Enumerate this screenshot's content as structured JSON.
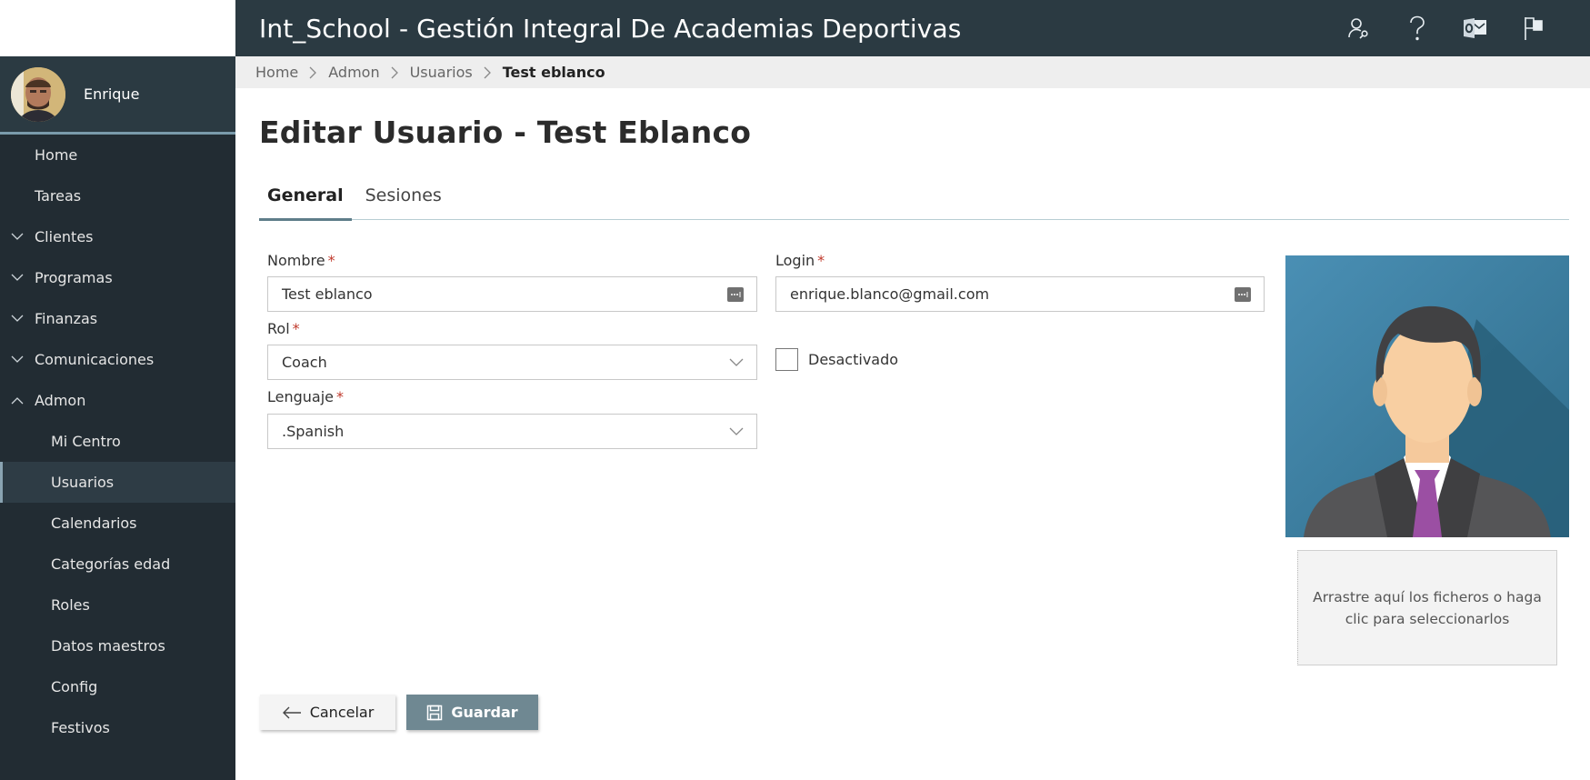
{
  "header": {
    "title": "Int_School - Gestión Integral De Academias Deportivas",
    "icons": [
      "user-search-icon",
      "help-icon",
      "outlook-icon",
      "flag-icon"
    ]
  },
  "user": {
    "name": "Enrique"
  },
  "sidebar": {
    "items": [
      {
        "label": "Home",
        "type": "top"
      },
      {
        "label": "Tareas",
        "type": "top"
      },
      {
        "label": "Clientes",
        "type": "group",
        "expanded": false
      },
      {
        "label": "Programas",
        "type": "group",
        "expanded": false
      },
      {
        "label": "Finanzas",
        "type": "group",
        "expanded": false
      },
      {
        "label": "Comunicaciones",
        "type": "group",
        "expanded": false
      },
      {
        "label": "Admon",
        "type": "group",
        "expanded": true
      },
      {
        "label": "Mi Centro",
        "type": "sub"
      },
      {
        "label": "Usuarios",
        "type": "sub",
        "active": true
      },
      {
        "label": "Calendarios",
        "type": "sub"
      },
      {
        "label": "Categorías edad",
        "type": "sub"
      },
      {
        "label": "Roles",
        "type": "sub"
      },
      {
        "label": "Datos maestros",
        "type": "sub"
      },
      {
        "label": "Config",
        "type": "sub"
      },
      {
        "label": "Festivos",
        "type": "sub"
      }
    ]
  },
  "breadcrumb": [
    "Home",
    "Admon",
    "Usuarios",
    "Test eblanco"
  ],
  "page": {
    "title": "Editar Usuario - Test Eblanco"
  },
  "tabs": [
    {
      "label": "General",
      "active": true
    },
    {
      "label": "Sesiones",
      "active": false
    }
  ],
  "form": {
    "nombre": {
      "label": "Nombre",
      "required": "*",
      "value": "Test eblanco"
    },
    "login": {
      "label": "Login",
      "required": "*",
      "value": "enrique.blanco@gmail.com"
    },
    "rol": {
      "label": "Rol",
      "required": "*",
      "value": "Coach"
    },
    "lenguaje": {
      "label": "Lenguaje",
      "required": "*",
      "value": ".Spanish"
    },
    "desactivado": {
      "label": "Desactivado",
      "checked": false
    }
  },
  "photo": {
    "dropzone_text": "Arrastre aquí los ficheros o haga clic para seleccionarlos"
  },
  "actions": {
    "cancel_label": "Cancelar",
    "save_label": "Guardar"
  },
  "colors": {
    "header_bg": "#2b3a42",
    "sidebar_bg": "#222c33",
    "accent": "#5e7d89",
    "save_button": "#6f8892",
    "required": "#c0392b"
  }
}
